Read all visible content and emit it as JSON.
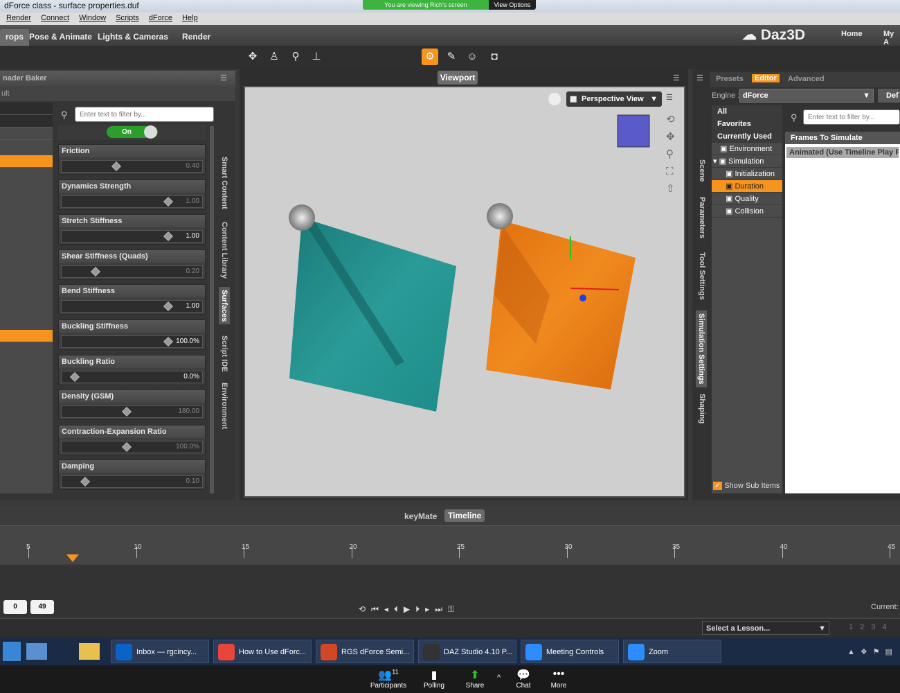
{
  "title": "dForce class - surface properties.duf",
  "share_banner": "You are viewing Rich's screen",
  "view_options": "View Options",
  "menu": [
    "Render",
    "Connect",
    "Window",
    "Scripts",
    "dForce",
    "Help"
  ],
  "tabs": [
    "rops",
    "Pose & Animate",
    "Lights & Cameras",
    "Render"
  ],
  "brand": "Daz3D",
  "brand_links": [
    "Home",
    "My A"
  ],
  "left": {
    "title": "nader Baker",
    "sub": "ult",
    "filter_placeholder": "Enter text to filter by...",
    "toggle": "On",
    "props": [
      {
        "label": "Friction",
        "value": "0.40",
        "fill": 0.45,
        "hi": false
      },
      {
        "label": "Dynamics Strength",
        "value": "1.00",
        "fill": 0.95,
        "hi": false
      },
      {
        "label": "Stretch Stiffness",
        "value": "1.00",
        "fill": 0.95,
        "hi": true
      },
      {
        "label": "Shear Stiffness (Quads)",
        "value": "0.20",
        "fill": 0.25,
        "hi": false
      },
      {
        "label": "Bend Stiffness",
        "value": "1.00",
        "fill": 0.95,
        "hi": true
      },
      {
        "label": "Buckling Stiffness",
        "value": "100.0%",
        "fill": 0.95,
        "hi": true
      },
      {
        "label": "Buckling Ratio",
        "value": "0.0%",
        "fill": 0.05,
        "hi": true
      },
      {
        "label": "Density (GSM)",
        "value": "180.00",
        "fill": 0.55,
        "hi": false
      },
      {
        "label": "Contraction-Expansion Ratio",
        "value": "100.0%",
        "fill": 0.55,
        "hi": false
      },
      {
        "label": "Damping",
        "value": "0.10",
        "fill": 0.15,
        "hi": false
      }
    ],
    "vtabs": [
      "Smart Content",
      "Content Library",
      "Surfaces",
      "Script IDE",
      "Environment"
    ]
  },
  "viewport": {
    "tab": "Viewport",
    "view": "Perspective View"
  },
  "right": {
    "tabs": [
      "Presets",
      "Editor",
      "Advanced"
    ],
    "engine_label": "Engine :",
    "engine": "dForce",
    "def": "Def",
    "tree": [
      {
        "label": "All",
        "kind": "h"
      },
      {
        "label": "Favorites",
        "kind": "h"
      },
      {
        "label": "Currently Used",
        "kind": "h"
      },
      {
        "label": "Environment",
        "kind": "i"
      },
      {
        "label": "Simulation",
        "kind": "i"
      },
      {
        "label": "Initialization",
        "kind": "c"
      },
      {
        "label": "Duration",
        "kind": "sel"
      },
      {
        "label": "Quality",
        "kind": "c"
      },
      {
        "label": "Collision",
        "kind": "c"
      }
    ],
    "filter_placeholder": "Enter text to filter by...",
    "param_header": "Frames To Simulate",
    "param_value": "Animated (Use Timeline Play Ra",
    "show_sub": "Show Sub Items",
    "vtabs": [
      "Scene",
      "Parameters",
      "Tool Settings",
      "Simulation Settings",
      "Shaping"
    ]
  },
  "timeline": {
    "tabs": [
      "keyMate",
      "Timeline"
    ],
    "ticks": [
      5,
      10,
      15,
      20,
      25,
      30,
      35,
      40,
      45
    ],
    "start": "0",
    "end": "49",
    "current": "Current:"
  },
  "lesson": "Select a Lesson...",
  "lesson_pages": [
    "1",
    "2",
    "3",
    "4"
  ],
  "taskbar": [
    {
      "label": "Inbox — rgcincy...",
      "color": "#0a64c8"
    },
    {
      "label": "How to Use dForc...",
      "color": "#e8453c"
    },
    {
      "label": "RGS dForce Semi...",
      "color": "#d24726"
    },
    {
      "label": "DAZ Studio 4.10 P...",
      "color": "#333333"
    },
    {
      "label": "Meeting Controls",
      "color": "#2d8cff"
    },
    {
      "label": "Zoom",
      "color": "#2d8cff"
    }
  ],
  "zoom": [
    {
      "label": "Participants",
      "icon": "👥",
      "badge": "11"
    },
    {
      "label": "Polling",
      "icon": "▮"
    },
    {
      "label": "Share",
      "icon": "⬆"
    },
    {
      "label": "Chat",
      "icon": "💬"
    },
    {
      "label": "More",
      "icon": "•••"
    }
  ]
}
